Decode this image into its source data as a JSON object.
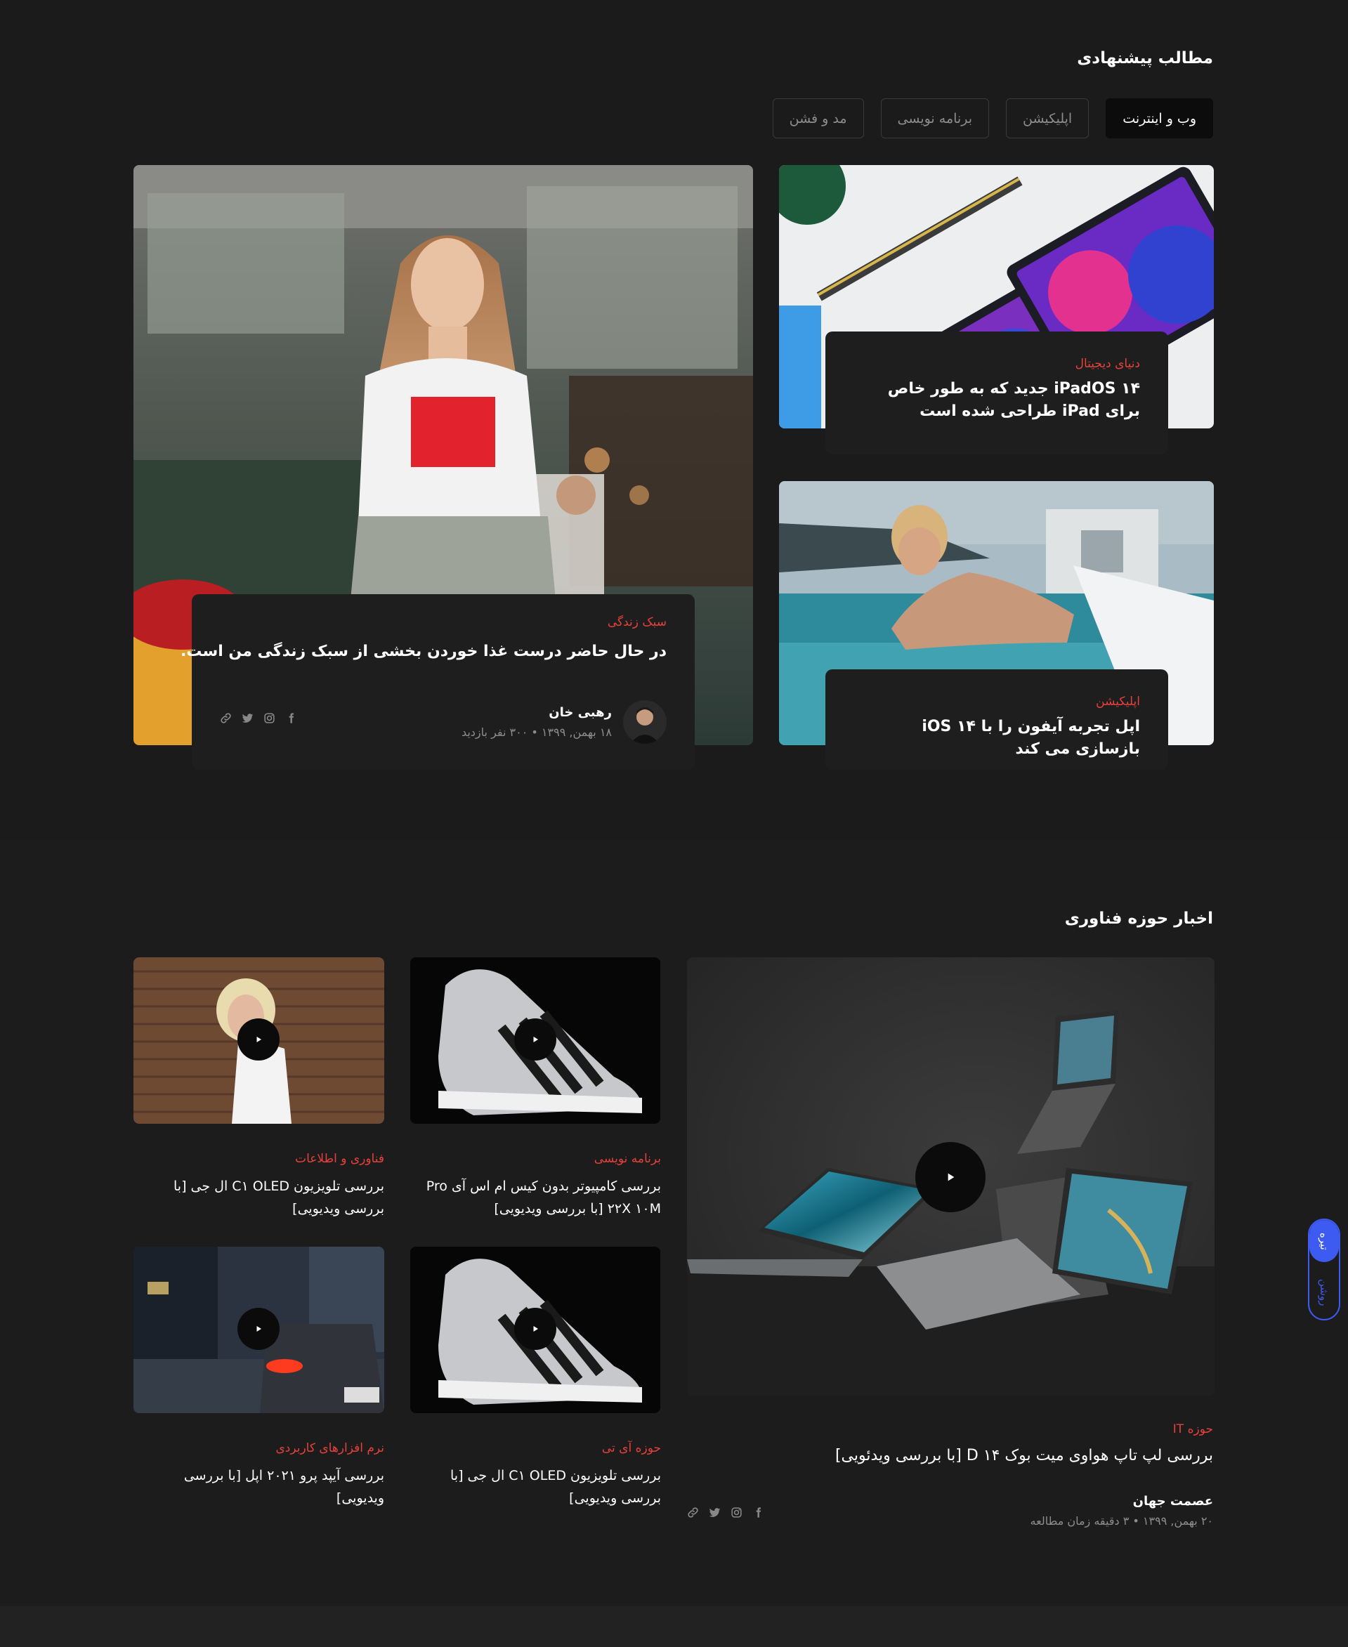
{
  "suggested": {
    "title": "مطالب پیشنهادی",
    "tabs": [
      "وب و اینترنت",
      "اپلیکیشن",
      "برنامه نویسی",
      "مد و فشن"
    ],
    "active_tab": 0,
    "featured": {
      "category": "سبک زندگی",
      "title": "در حال حاضر درست غذا خوردن بخشی از سبک زندگی من است.",
      "author": "رهبی خان",
      "meta": "۱۸ بهمن, ۱۳۹۹ • ۳۰۰ نفر بازدید"
    },
    "side_posts": [
      {
        "category": "دنیای دیجیتال",
        "title": "iPadOS ۱۴ جدید که به طور خاص برای iPad طراحی شده است"
      },
      {
        "category": "اپلیکیشن",
        "title": "اپل تجربه آیفون را با iOS ۱۴ بازسازی می کند"
      }
    ]
  },
  "tech_news": {
    "title": "اخبار حوزه فناوری",
    "main": {
      "category": "حوزه IT",
      "title": "بررسی لپ تاپ هواوی میت بوک D ۱۴ [با بررسی ویدئویی]",
      "author": "عصمت جهان",
      "meta": "۲۰ بهمن, ۱۳۹۹ • ۳ دقیقه زمان مطالعه"
    },
    "videos": [
      {
        "category": "برنامه نویسی",
        "title": "بررسی کامپیوتر بدون کیس ام اس آی Pro ۲۲X ۱۰M [با بررسی ویدیویی]"
      },
      {
        "category": "فناوری و اطلاعات",
        "title": "بررسی تلویزیون C۱ OLED ال جی [با بررسی ویدیویی]"
      },
      {
        "category": "حوزه آی تی",
        "title": "بررسی تلویزیون C۱ OLED ال جی [با بررسی ویدیویی]"
      },
      {
        "category": "نرم افزارهای کاربردی",
        "title": "بررسی آیپد پرو ۲۰۲۱ اپل [با بررسی ویدیویی]"
      }
    ]
  },
  "theme_toggle": {
    "dark": "تیره",
    "light": "روشن"
  },
  "colors": {
    "accent_red": "#e6413b",
    "toggle_blue": "#3d5af1",
    "background": "#1b1b1b",
    "card": "#1e1e1e"
  },
  "icons": [
    "facebook-icon",
    "instagram-icon",
    "twitter-icon",
    "link-icon",
    "play-icon"
  ]
}
